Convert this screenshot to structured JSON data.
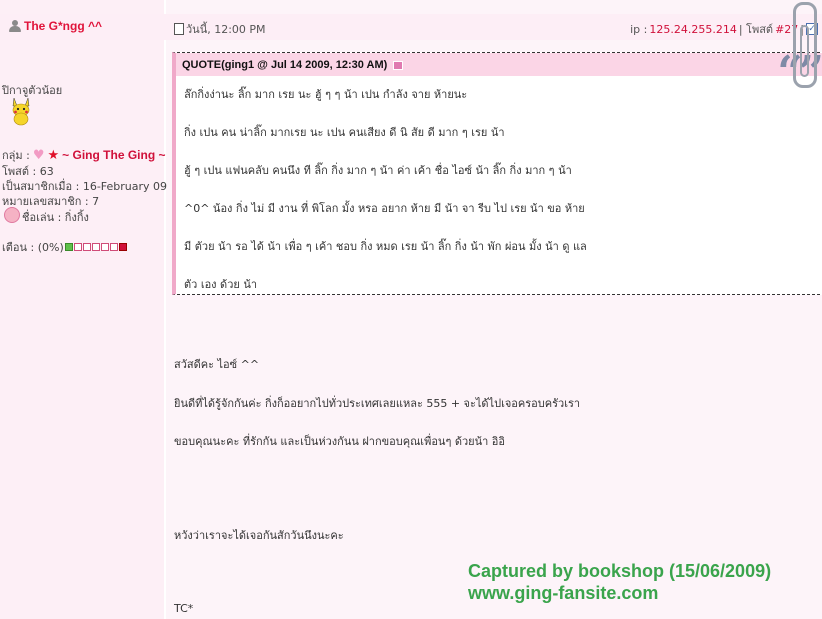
{
  "user": {
    "name": "The G*ngg ^^"
  },
  "header": {
    "date": "วันนี้, 12:00 PM",
    "ip_label": "ip : ",
    "ip_value": "125.24.255.214",
    "post_sep": " | โพสต์ ",
    "post_number": "#27",
    "post_sep2": " |"
  },
  "profile": {
    "title_line": "ปิกาจูตัวน้อย",
    "group_label": "กลุ่ม :",
    "group_name": "~ Ging The Ging ~",
    "posts": "โพสต์ : 63",
    "joined": "เป็นสมาชิกเมื่อ : 16-February 09",
    "member_no": "หมายเลขสมาชิก : 7",
    "nickname": "ชื่อเล่น : กิ่งกิ้ง",
    "warning": "เตือน : (0%)"
  },
  "quote": {
    "title": "QUOTE(ging1 @ Jul 14 2009, 12:30 AM)",
    "lines": [
      "ล๊กกิ่งง่านะ ลิ๊ก มาก เรย นะ ฮู้ ๆ ๆ น้า เปน กำลัง จาย ห้ายนะ",
      "กิ่ง เปน คน น่าลิ๊ก มากเรย นะ เปน คนเสียง ดี นิ สัย ดี มาก ๆ เรย น้า",
      "ฮู้ ๆ เปน แฟนคลับ คนนึง ที ลิ๊ก กิ่ง มาก ๆ น้า ค่า เค้า ชื่อ ไอซ์ น้า ลิ๊ก กิ่ง มาก ๆ น้า",
      "^0^ น้อง กิ่ง ไม่ มี งาน ที่ พิโลก มั้ง หรอ อยาก ห้าย มี น้า จา รีบ ไป เรย น้า ขอ ห้าย",
      "มี ตัวย น้า รอ ได้ น้า เพื่อ ๆ เค้า ชอบ กิ่ง หมด เรย น้า ลิ๊ก กิ่ง น้า พัก ผ่อน มั้ง น้า ดู แล",
      "ตัว เอง ด้วย น้า"
    ]
  },
  "body": {
    "lines": [
      "สวัสดีคะ ไอซ์ ^^",
      "ยินดีที่ได้รู้จักกันค่ะ กิ่งก็ออยากไปทั่วประเทศเลยแหละ 555 + จะได้ไปเจอครอบครัวเรา",
      "ขอบคุณนะคะ ที่รักกัน และเป็นห่วงกันน ฝากขอบคุณเพื่อนๆ ด้วยน้า อิอิ",
      "หวังว่าเราจะได้เจอกันสักวันนึงนะคะ",
      "TC*"
    ]
  },
  "watermark": {
    "line1": "Captured by bookshop (15/06/2009)",
    "line2": "www.ging-fansite.com"
  },
  "colors": {
    "accent": "#d0103a",
    "quote_header": "#fbd5e6",
    "watermark": "#3aa44c"
  }
}
